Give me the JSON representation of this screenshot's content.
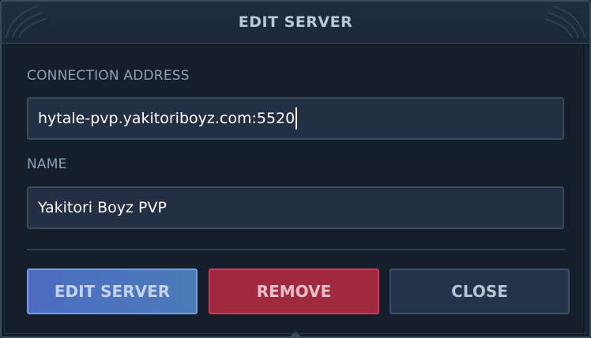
{
  "dialog": {
    "title": "EDIT SERVER"
  },
  "form": {
    "address_label": "CONNECTION ADDRESS",
    "address_value": "hytale-pvp.yakitoriboyz.com:5520",
    "name_label": "NAME",
    "name_value": "Yakitori Boyz PVP"
  },
  "buttons": {
    "edit_label": "EDIT SERVER",
    "remove_label": "REMOVE",
    "close_label": "CLOSE"
  },
  "colors": {
    "accent": "#4c6cc3",
    "danger": "#a0283f",
    "background": "#151e2b"
  }
}
